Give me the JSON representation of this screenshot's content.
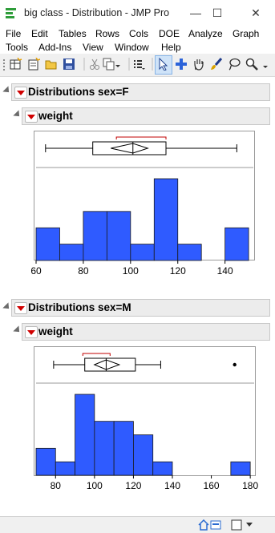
{
  "window": {
    "title": "big class - Distribution - JMP Pro"
  },
  "menu": {
    "row1": [
      "File",
      "Edit",
      "Tables",
      "Rows",
      "Cols",
      "DOE",
      "Analyze",
      "Graph"
    ],
    "row2": [
      "Tools",
      "Add-Ins",
      "View",
      "Window",
      "Help"
    ]
  },
  "toolbar": {
    "icons": [
      "new-table-icon",
      "new-script-icon",
      "open-icon",
      "save-icon",
      "cut-icon",
      "copy-icon",
      "paste-icon",
      "arrow-tool-icon",
      "crosshair-tool-icon",
      "hand-tool-icon",
      "brush-tool-icon",
      "lasso-tool-icon",
      "magnifier-tool-icon"
    ]
  },
  "groups": [
    {
      "title": "Distributions sex=F",
      "variable": "weight",
      "chart_data": {
        "type": "bar",
        "title": "",
        "xlabel": "",
        "ylabel": "",
        "bin_edges": [
          60,
          70,
          80,
          90,
          100,
          110,
          120,
          130,
          140,
          150
        ],
        "counts": [
          2,
          1,
          3,
          3,
          1,
          5,
          1,
          0,
          2
        ],
        "xlim": [
          60,
          152
        ],
        "x_ticks": [
          "60",
          "80",
          "100",
          "120",
          "140"
        ],
        "boxplot": {
          "min": 64,
          "q1": 84,
          "median": 101,
          "q3": 115,
          "max": 145,
          "shortest_half": [
            94,
            115
          ],
          "outliers": []
        },
        "bar_color": "#2f5bff"
      }
    },
    {
      "title": "Distributions sex=M",
      "variable": "weight",
      "chart_data": {
        "type": "bar",
        "title": "",
        "xlabel": "",
        "ylabel": "",
        "bin_edges": [
          70,
          80,
          90,
          100,
          110,
          120,
          130,
          140,
          150,
          160,
          170,
          180
        ],
        "counts": [
          2,
          1,
          6,
          4,
          4,
          3,
          1,
          0,
          0,
          0,
          1
        ],
        "xlim": [
          70,
          182
        ],
        "x_ticks": [
          "80",
          "100",
          "120",
          "140",
          "160",
          "180"
        ],
        "boxplot": {
          "min": 79,
          "q1": 95,
          "median": 106,
          "q3": 121,
          "max": 134,
          "shortest_half": [
            94,
            108
          ],
          "outliers": [
            172
          ]
        },
        "bar_color": "#2f5bff"
      }
    }
  ]
}
